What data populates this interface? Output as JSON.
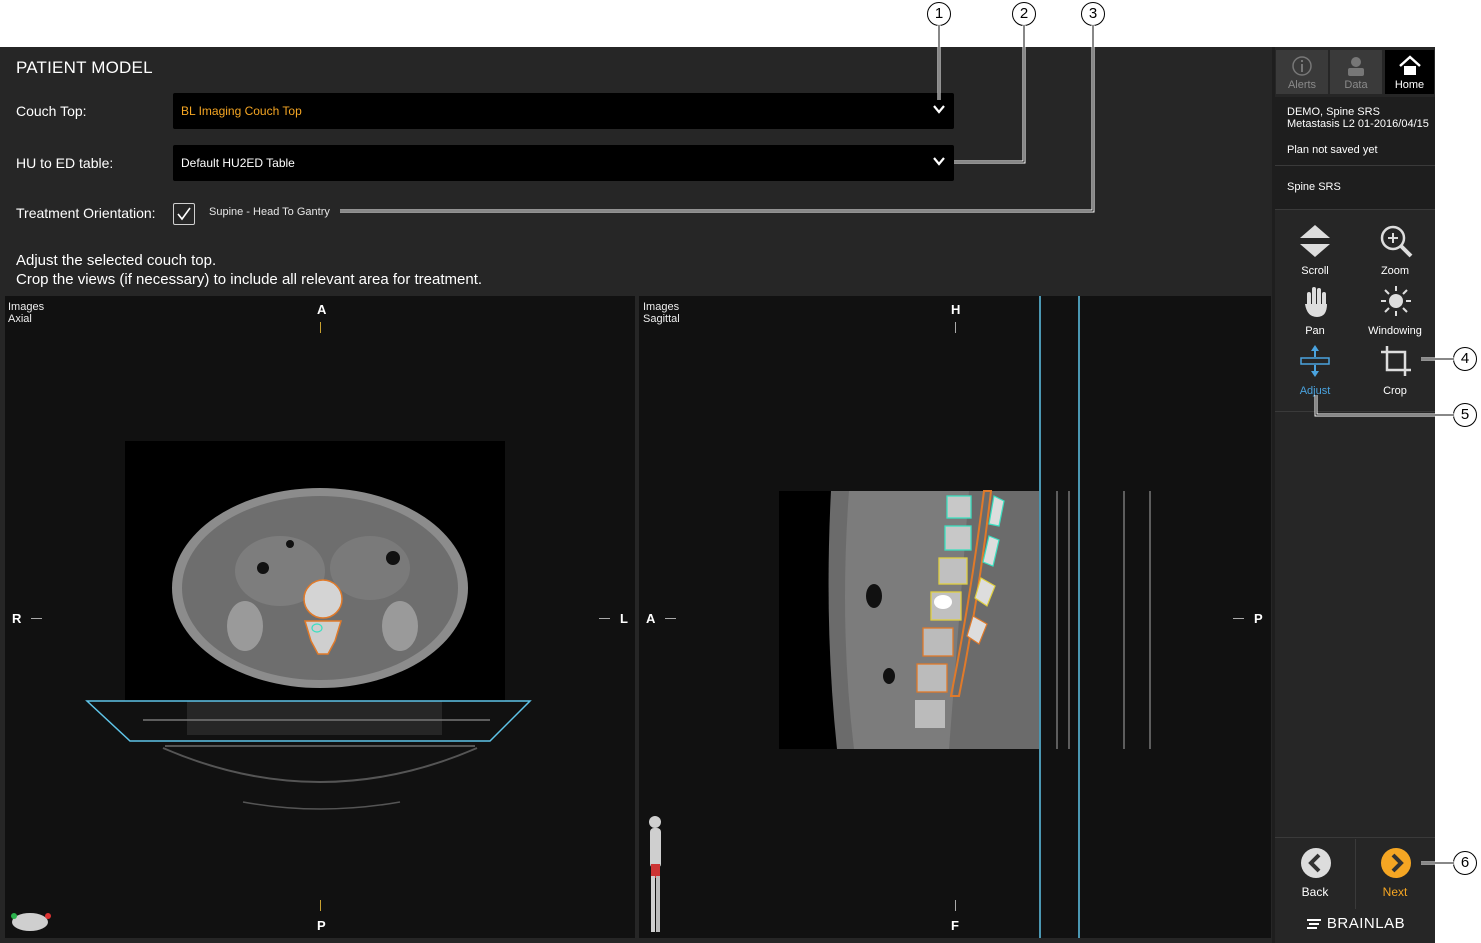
{
  "header": {
    "title": "PATIENT MODEL"
  },
  "form": {
    "couch_top": {
      "label": "Couch Top:",
      "value": "BL Imaging Couch Top"
    },
    "hu_table": {
      "label": "HU to ED table:",
      "value": "Default HU2ED Table"
    },
    "orientation": {
      "label": "Treatment Orientation:",
      "value": "Supine - Head To Gantry"
    }
  },
  "instructions": {
    "line1": "Adjust the selected couch top.",
    "line2": "Crop the views (if necessary) to include all relevant area for treatment."
  },
  "views": {
    "axial": {
      "title1": "Images",
      "title2": "Axial",
      "top": "A",
      "bottom": "P",
      "left": "R",
      "right": "L"
    },
    "sagittal": {
      "title1": "Images",
      "title2": "Sagittal",
      "top": "H",
      "bottom": "F",
      "left": "A",
      "right": "P"
    }
  },
  "sidebar": {
    "top_buttons": {
      "alerts": "Alerts",
      "data": "Data",
      "home": "Home"
    },
    "patient": {
      "name": "DEMO, Spine SRS",
      "study": "Metastasis L2 01-2016/04/15",
      "status": "Plan not saved yet",
      "plan": "Spine SRS"
    },
    "tools": {
      "scroll": "Scroll",
      "zoom": "Zoom",
      "pan": "Pan",
      "windowing": "Windowing",
      "adjust": "Adjust",
      "crop": "Crop"
    },
    "nav": {
      "back": "Back",
      "next": "Next"
    },
    "brand": "BRAINLAB"
  },
  "callouts": [
    "1",
    "2",
    "3",
    "4",
    "5",
    "6"
  ],
  "colors": {
    "accent": "#f5a623",
    "adjust_active": "#4aa3df",
    "couch_outline": "#5fc4e8"
  }
}
